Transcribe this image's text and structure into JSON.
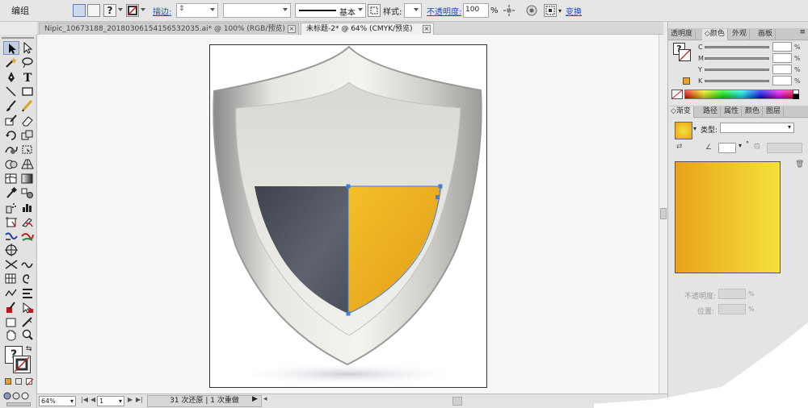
{
  "control_bar": {
    "selection_label": "编组",
    "stroke_label": "描边:",
    "stroke_profile": "基本",
    "style_label": "样式:",
    "opacity_label": "不透明度:",
    "opacity_value": "100",
    "opacity_unit": "%",
    "transform_link": "变换"
  },
  "tabs": [
    {
      "label": "Nipic_10673188_20180306154156532035.ai* @ 100% (RGB/预览)",
      "active": false
    },
    {
      "label": "未标题-2* @ 64% (CMYK/预览)",
      "active": true
    }
  ],
  "status_bar": {
    "zoom": "64%",
    "page": "1",
    "undo_redo": "31 次还原 | 1 次重做"
  },
  "panels": {
    "top_tabs": [
      "透明度",
      "颜色",
      "外观",
      "画板"
    ],
    "color": {
      "channels": [
        "C",
        "M",
        "Y",
        "K"
      ],
      "percent_unit": "%"
    },
    "gradient_tabs": [
      "渐变",
      "路径",
      "属性",
      "颜色",
      "图层"
    ],
    "gradient": {
      "type_label": "类型:",
      "angle_unit": "°",
      "opacity_label": "不透明度:",
      "location_label": "位置:",
      "percent_unit": "%",
      "start_color": "#E8A21C",
      "end_color": "#F4E23A"
    }
  },
  "colors": {
    "accent": "#1a4cc4",
    "shield_dark": "#4a4e59",
    "shield_yellow": "#EDB321"
  }
}
